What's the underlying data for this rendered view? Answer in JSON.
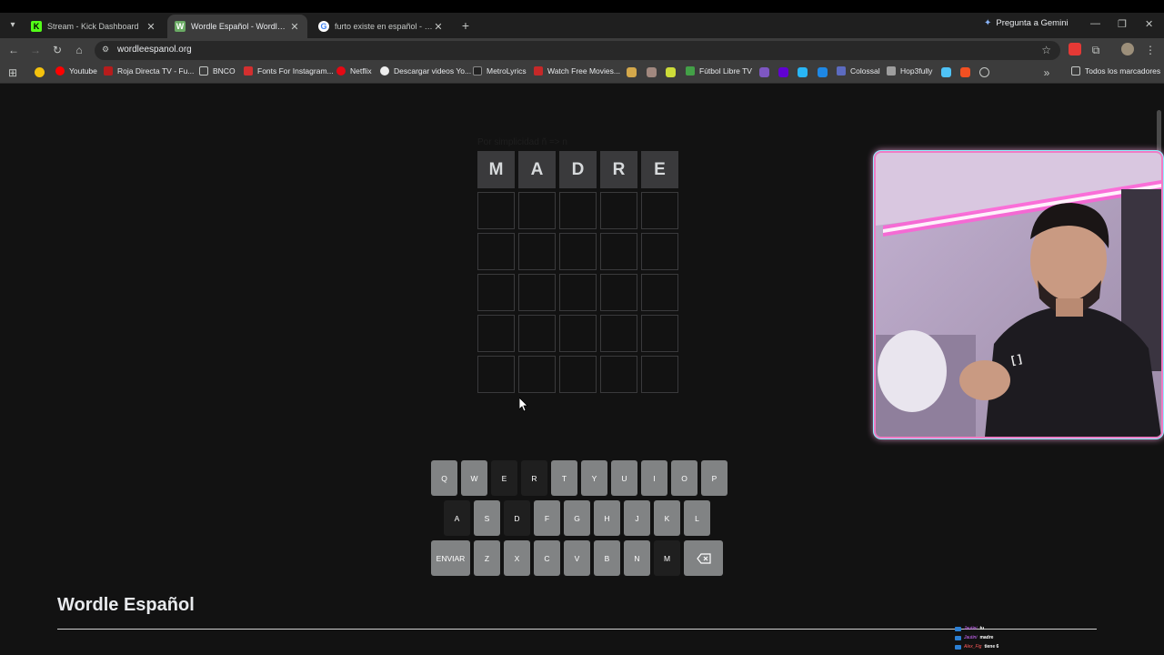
{
  "browser": {
    "tabs": [
      {
        "title": "Stream - Kick Dashboard",
        "icon": "kick-icon",
        "color": "#53fc18"
      },
      {
        "title": "Wordle Español - Wordle ilimit",
        "icon": "wordle-icon",
        "color": "#6aaa64"
      },
      {
        "title": "furto existe en español - Busca",
        "icon": "google-icon",
        "color": "#4285f4"
      }
    ],
    "gemini_label": "Pregunta a Gemini",
    "url": "wordleespanol.org",
    "bookmarks": [
      "Youtube",
      "Roja Directa TV - Fu...",
      "BNCO",
      "Fonts For Instagram...",
      "Netflix",
      "Descargar videos Yo...",
      "MetroLyrics",
      "Watch Free Movies...",
      "Fútbol Libre TV",
      "Colossal",
      "Hop3fully"
    ],
    "all_bookmarks": "Todos los marcadores"
  },
  "page": {
    "hint": "Por simplicidad ñ => n",
    "board": [
      [
        "M",
        "A",
        "D",
        "R",
        "E"
      ],
      [
        "",
        "",
        "",
        "",
        ""
      ],
      [
        "",
        "",
        "",
        "",
        ""
      ],
      [
        "",
        "",
        "",
        "",
        ""
      ],
      [
        "",
        "",
        "",
        "",
        ""
      ],
      [
        "",
        "",
        "",
        "",
        ""
      ]
    ],
    "keyboard": {
      "row1": [
        "Q",
        "W",
        "E",
        "R",
        "T",
        "Y",
        "U",
        "I",
        "O",
        "P"
      ],
      "row2": [
        "A",
        "S",
        "D",
        "F",
        "G",
        "H",
        "J",
        "K",
        "L"
      ],
      "row3": [
        "ENVIAR",
        "Z",
        "X",
        "C",
        "V",
        "B",
        "N",
        "M"
      ],
      "absent_keys": [
        "E",
        "R",
        "A",
        "D",
        "M"
      ],
      "backspace_icon": "backspace-icon"
    },
    "title": "Wordle Español"
  },
  "chat": [
    {
      "user": "Jautini",
      "message": "tu"
    },
    {
      "user": "Jautini",
      "message": "madre"
    },
    {
      "user": "Alex_Fig",
      "message": "tiene 6"
    }
  ],
  "colors": {
    "filled_tile": "#3a3a3c",
    "key_default": "#818384",
    "key_absent": "#1f1f1f",
    "cam_border": "#f07cc4"
  }
}
